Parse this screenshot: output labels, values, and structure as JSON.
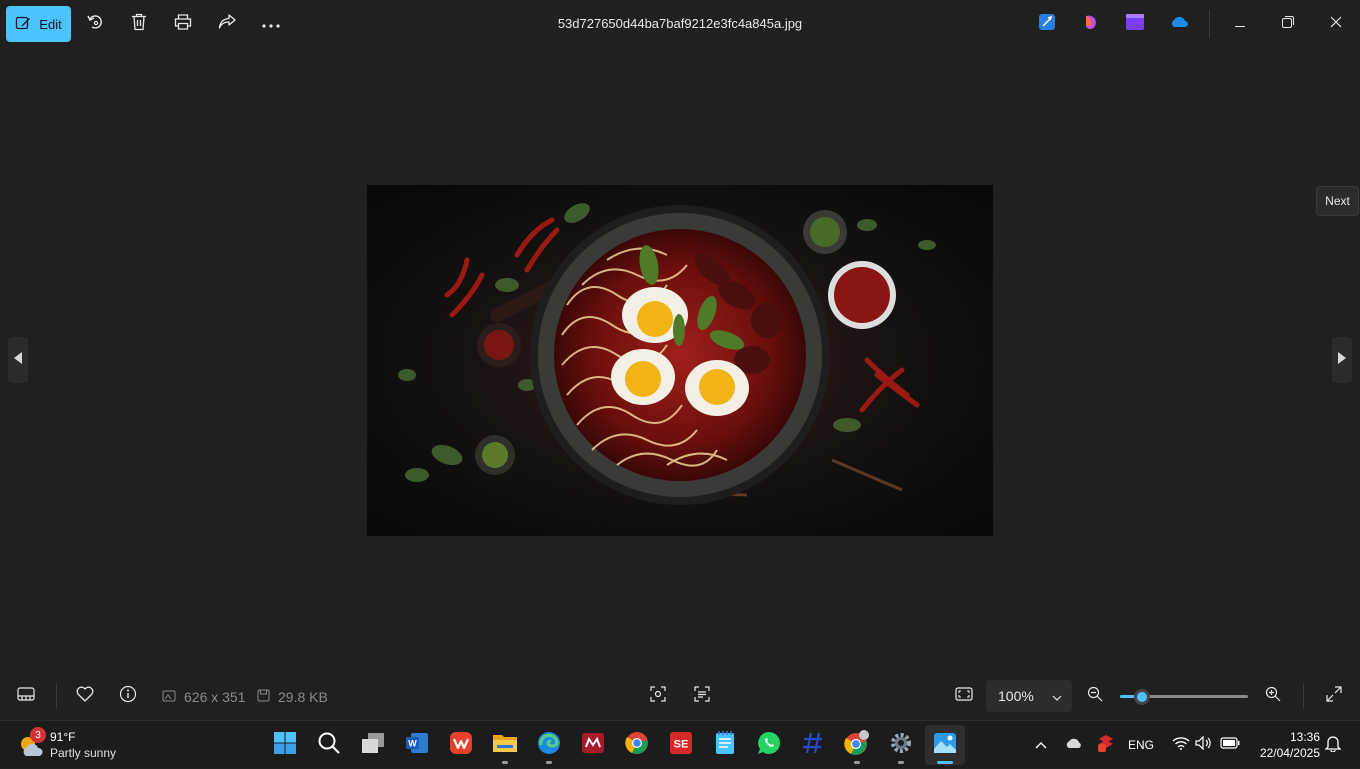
{
  "topbar": {
    "edit_label": "Edit",
    "filename": "53d727650d44ba7baf9212e3fc4a845a.jpg",
    "icons": [
      "edit-icon",
      "rotate-icon",
      "delete-icon",
      "print-icon",
      "share-icon",
      "more-icon",
      "designer-icon",
      "clipchamp-icon",
      "video-editor-icon",
      "onedrive-icon",
      "minimize-icon",
      "maximize-icon",
      "close-icon"
    ]
  },
  "viewer": {
    "tooltip": "Next"
  },
  "bottombar": {
    "dimensions": "626 x 351",
    "filesize": "29.8 KB",
    "zoom": "100%",
    "zoom_fraction": 0.17
  },
  "taskbar": {
    "weather_temp": "91°F",
    "weather_condition": "Partly sunny",
    "weather_badge": "3",
    "language": "ENG",
    "time": "13:36",
    "date": "22/04/2025"
  },
  "colors": {
    "accent": "#4cc2ff",
    "background": "#202020",
    "taskbar": "#1c1c1c"
  }
}
